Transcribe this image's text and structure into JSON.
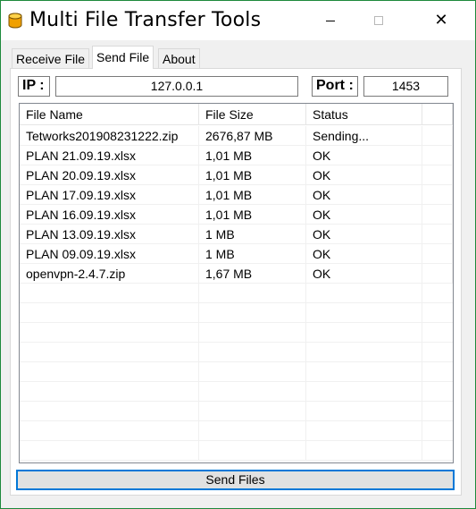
{
  "window": {
    "title": "Multi File Transfer Tools",
    "close_glyph": "✕"
  },
  "tabs": [
    {
      "label": "Receive File",
      "active": false
    },
    {
      "label": "Send File",
      "active": true
    },
    {
      "label": "About",
      "active": false
    }
  ],
  "connection": {
    "ip_label": "IP :",
    "ip_value": "127.0.0.1",
    "port_label": "Port :",
    "port_value": "1453"
  },
  "file_list": {
    "columns": [
      "File Name",
      "File Size",
      "Status"
    ],
    "rows": [
      {
        "name": "Tetworks201908231222.zip",
        "size": "2676,87 MB",
        "status": "Sending..."
      },
      {
        "name": "PLAN 21.09.19.xlsx",
        "size": "1,01 MB",
        "status": "OK"
      },
      {
        "name": "PLAN 20.09.19.xlsx",
        "size": "1,01 MB",
        "status": "OK"
      },
      {
        "name": "PLAN 17.09.19.xlsx",
        "size": "1,01 MB",
        "status": "OK"
      },
      {
        "name": "PLAN 16.09.19.xlsx",
        "size": "1,01 MB",
        "status": "OK"
      },
      {
        "name": "PLAN 13.09.19.xlsx",
        "size": "1 MB",
        "status": "OK"
      },
      {
        "name": "PLAN 09.09.19.xlsx",
        "size": "1 MB",
        "status": "OK"
      },
      {
        "name": "openvpn-2.4.7.zip",
        "size": "1,67 MB",
        "status": "OK"
      }
    ]
  },
  "actions": {
    "send_label": "Send Files"
  },
  "colors": {
    "accent": "#0078d7",
    "window_border": "#1e8a3c",
    "icon_body": "#f0a000"
  }
}
